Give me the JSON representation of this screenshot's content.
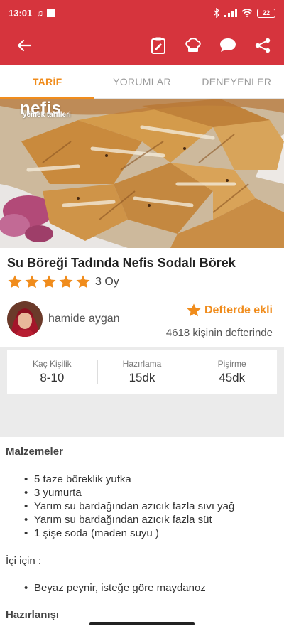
{
  "status_bar": {
    "time": "13:01",
    "battery": "22"
  },
  "tabs": [
    {
      "label": "TARİF"
    },
    {
      "label": "YORUMLAR"
    },
    {
      "label": "DENEYENLER"
    }
  ],
  "hero": {
    "logo_text": "nefis",
    "logo_subtext": "yemek tarifleri"
  },
  "recipe": {
    "title": "Su Böreği Tadında Nefis Sodalı Börek",
    "rating_stars": 5,
    "votes": "3 Oy",
    "author": "hamide aygan",
    "notebook_label": "Defterde ekli",
    "notebook_count": "4618 kişinin defterinde"
  },
  "info": [
    {
      "label": "Kaç Kişilik",
      "value": "8-10"
    },
    {
      "label": "Hazırlama",
      "value": "15dk"
    },
    {
      "label": "Pişirme",
      "value": "45dk"
    }
  ],
  "ingredients": {
    "heading": "Malzemeler",
    "items": [
      "5 taze böreklik yufka",
      "3 yumurta",
      "Yarım su bardağından azıcık fazla sıvı yağ",
      "Yarım su bardağından azıcık fazla süt",
      "1 şişe soda (maden suyu )"
    ],
    "filling_heading": "İçi için :",
    "filling_items": [
      "Beyaz peynir, isteğe göre maydanoz"
    ]
  },
  "preparation": {
    "heading": "Hazırlanışı"
  },
  "colors": {
    "primary": "#d6343d",
    "accent": "#f08c1c"
  },
  "icons": [
    "back-arrow-icon",
    "notebook-icon",
    "chef-hat-icon",
    "comment-icon",
    "share-icon",
    "star-icon"
  ]
}
